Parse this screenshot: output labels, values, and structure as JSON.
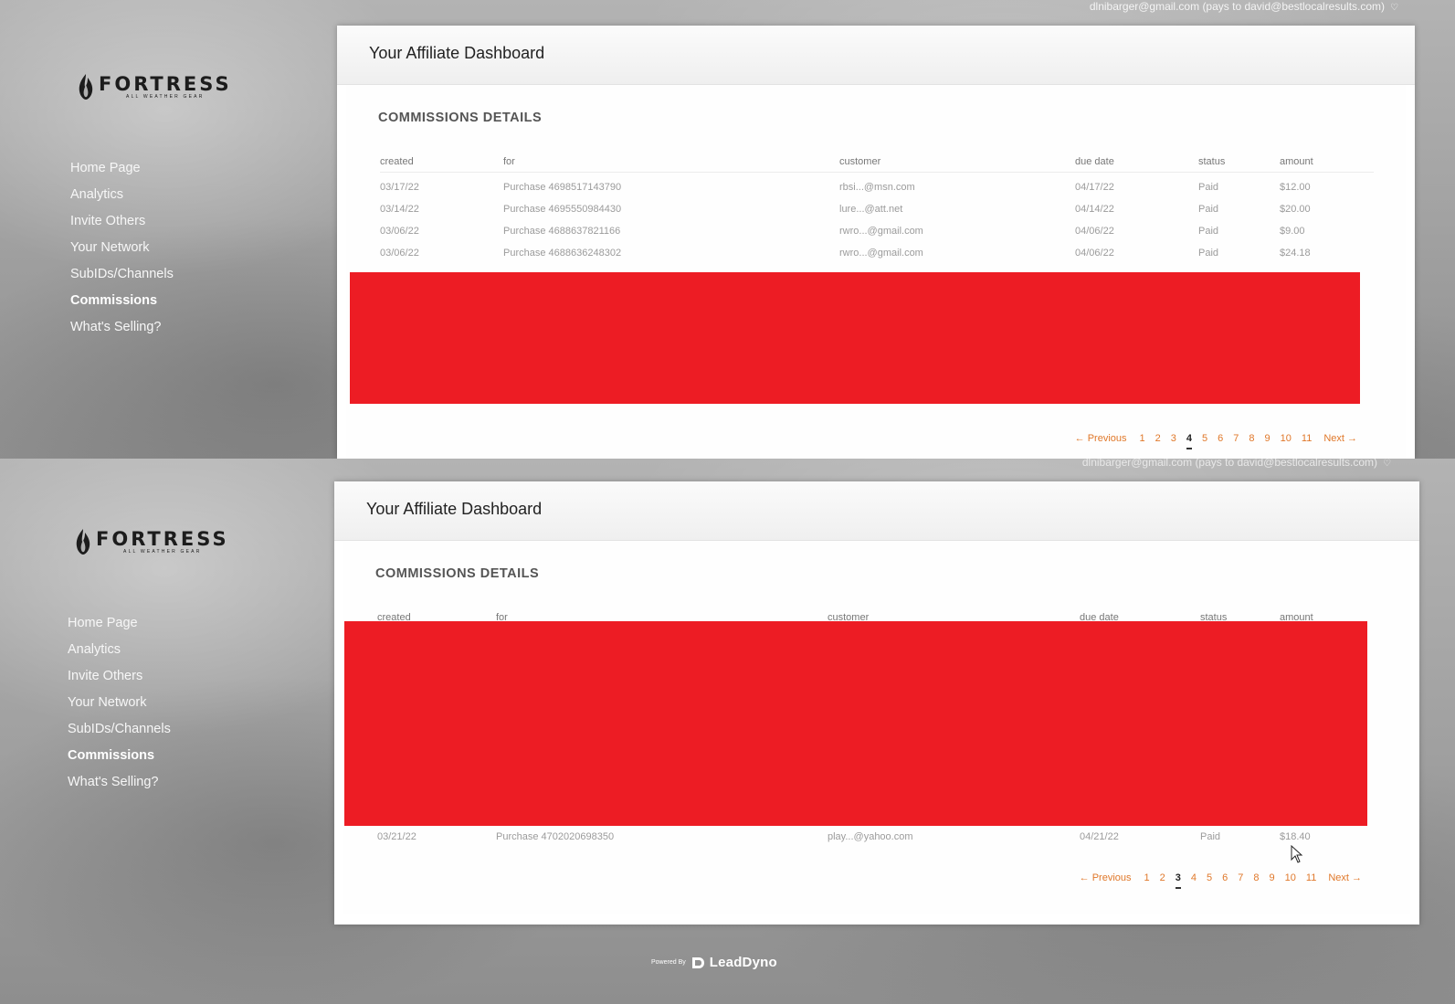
{
  "colors": {
    "accent": "#e0782a",
    "redaction": "#ed1c24",
    "active_nav": "#ffffff"
  },
  "icons": {
    "logo": "fortress-flame-logo",
    "account_caret": "heart-outline-icon",
    "leaddyno": "leaddyno-logo-icon",
    "cursor": "mouse-pointer-icon"
  },
  "shot1": {
    "account": "dlnibarger@gmail.com (pays to david@bestlocalresults.com)",
    "logo": {
      "brand": "FORTRESS",
      "tagline": "ALL WEATHER GEAR"
    },
    "nav": [
      "Home Page",
      "Analytics",
      "Invite Others",
      "Your Network",
      "SubIDs/Channels",
      "Commissions",
      "What's Selling?"
    ],
    "active_nav": "Commissions",
    "title": "Your Affiliate Dashboard",
    "section": "COMMISSIONS DETAILS",
    "columns": [
      "created",
      "for",
      "customer",
      "due date",
      "status",
      "amount"
    ],
    "rows": [
      [
        "03/17/22",
        "Purchase 4698517143790",
        "rbsi...@msn.com",
        "04/17/22",
        "Paid",
        "$12.00"
      ],
      [
        "03/14/22",
        "Purchase 4695550984430",
        "lure...@att.net",
        "04/14/22",
        "Paid",
        "$20.00"
      ],
      [
        "03/06/22",
        "Purchase 4688637821166",
        "rwro...@gmail.com",
        "04/06/22",
        "Paid",
        "$9.00"
      ],
      [
        "03/06/22",
        "Purchase 4688636248302",
        "rwro...@gmail.com",
        "04/06/22",
        "Paid",
        "$24.18"
      ]
    ],
    "pager": {
      "previous": "← Previous",
      "pages": [
        "1",
        "2",
        "3",
        "4",
        "5",
        "6",
        "7",
        "8",
        "9",
        "10",
        "11"
      ],
      "current": "4",
      "next": "Next →"
    }
  },
  "shot2": {
    "account": "dlnibarger@gmail.com (pays to david@bestlocalresults.com)",
    "logo": {
      "brand": "FORTRESS",
      "tagline": "ALL WEATHER GEAR"
    },
    "nav": [
      "Home Page",
      "Analytics",
      "Invite Others",
      "Your Network",
      "SubIDs/Channels",
      "Commissions",
      "What's Selling?"
    ],
    "active_nav": "Commissions",
    "title": "Your Affiliate Dashboard",
    "section": "COMMISSIONS DETAILS",
    "columns": [
      "created",
      "for",
      "customer",
      "due date",
      "status",
      "amount"
    ],
    "rows": [
      [
        "03/21/22",
        "Purchase 4702020698350",
        "play...@yahoo.com",
        "04/21/22",
        "Paid",
        "$18.40"
      ]
    ],
    "pager": {
      "previous": "← Previous",
      "pages": [
        "1",
        "2",
        "3",
        "4",
        "5",
        "6",
        "7",
        "8",
        "9",
        "10",
        "11"
      ],
      "current": "3",
      "next": "Next →"
    }
  },
  "footer": {
    "powered_by": "Powered By",
    "brand": "LeadDyno"
  }
}
